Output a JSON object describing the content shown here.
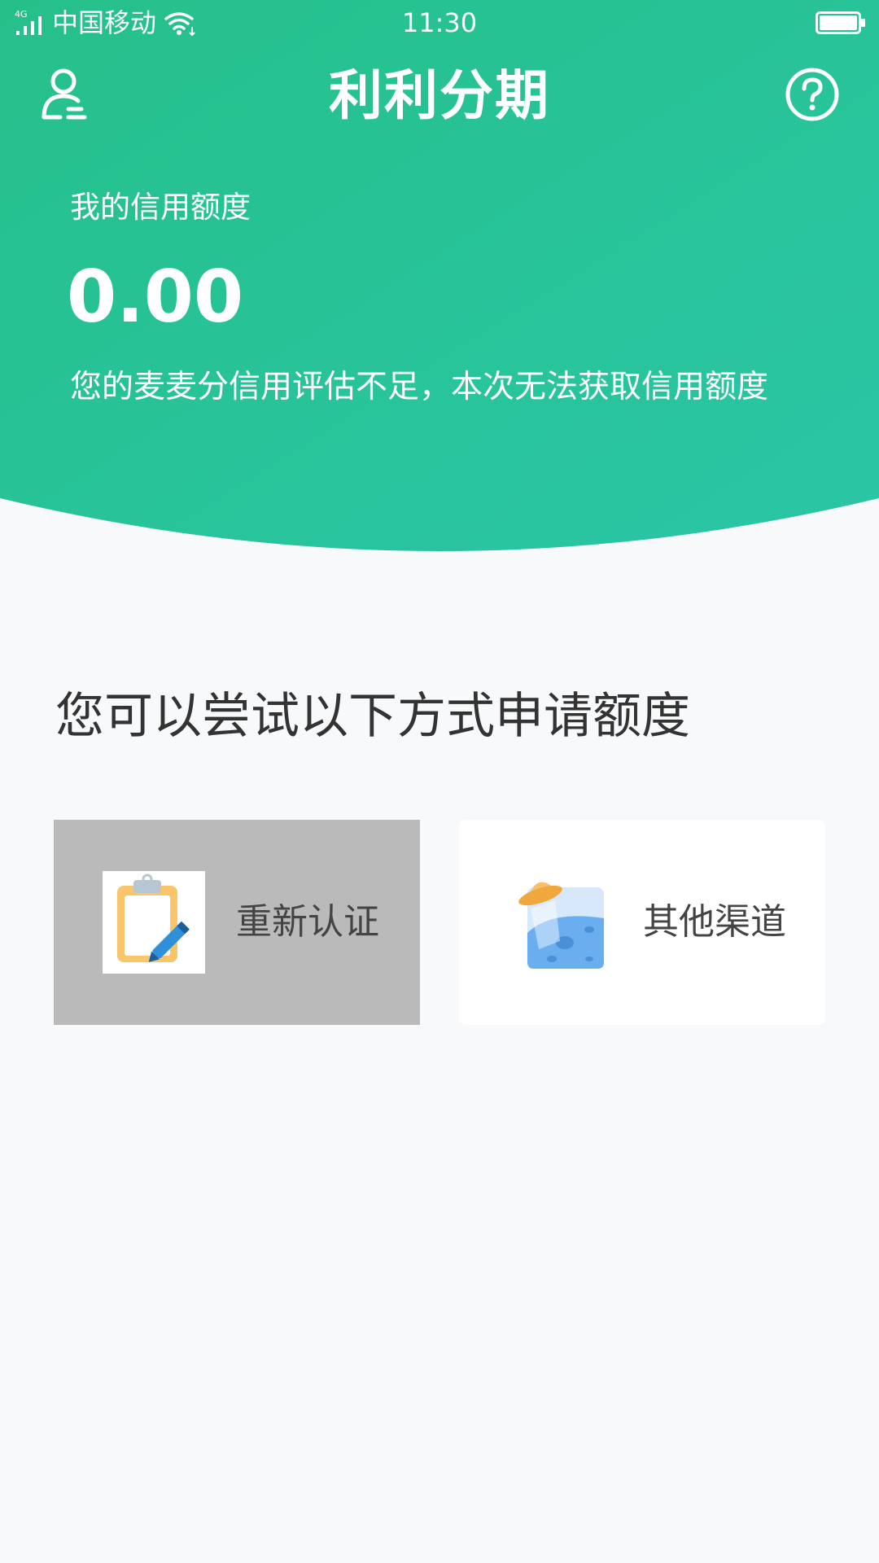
{
  "status_bar": {
    "network": "4G",
    "carrier": "中国移动",
    "time": "11:30"
  },
  "header": {
    "app_title": "利利分期",
    "user_icon": "user-icon",
    "help_icon": "help-circle-icon"
  },
  "credit": {
    "label": "我的信用额度",
    "amount": "0.00",
    "note": "您的麦麦分信用评估不足，本次无法获取信用额度"
  },
  "options": {
    "title": "您可以尝试以下方式申请额度",
    "items": [
      {
        "label": "重新认证",
        "icon": "clipboard-pen-icon"
      },
      {
        "label": "其他渠道",
        "icon": "ufo-planet-icon"
      }
    ]
  },
  "colors": {
    "hero_start": "#25c08a",
    "hero_end": "#2ac6a6",
    "page_bg": "#f7f9fb",
    "text_dark": "#333333",
    "card_pressed": "#bababa",
    "card_bg": "#ffffff"
  }
}
